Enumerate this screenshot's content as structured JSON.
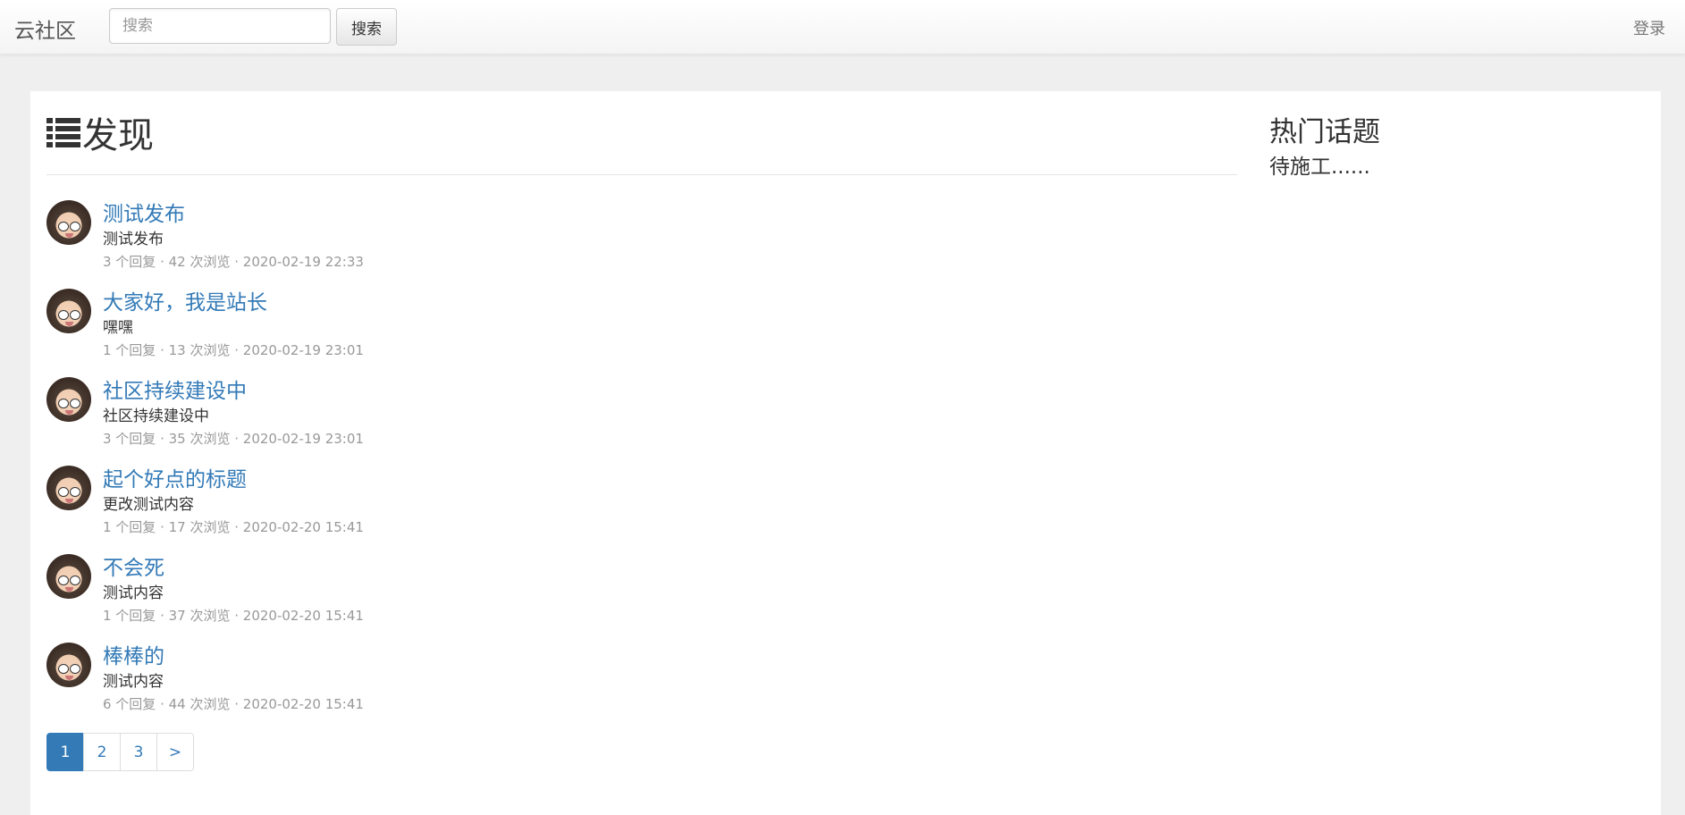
{
  "navbar": {
    "brand": "云社区",
    "search_placeholder": "搜索",
    "search_button": "搜索",
    "login": "登录"
  },
  "main": {
    "title": "发现",
    "title_icon": "list-icon",
    "topics": [
      {
        "title": "测试发布",
        "description": "测试发布",
        "meta": "3 个回复 · 42 次浏览 · 2020-02-19 22:33"
      },
      {
        "title": "大家好，我是站长",
        "description": "嘿嘿",
        "meta": "1 个回复 · 13 次浏览 · 2020-02-19 23:01"
      },
      {
        "title": "社区持续建设中",
        "description": "社区持续建设中",
        "meta": "3 个回复 · 35 次浏览 · 2020-02-19 23:01"
      },
      {
        "title": "起个好点的标题",
        "description": "更改测试内容",
        "meta": "1 个回复 · 17 次浏览 · 2020-02-20 15:41"
      },
      {
        "title": "不会死",
        "description": "测试内容",
        "meta": "1 个回复 · 37 次浏览 · 2020-02-20 15:41"
      },
      {
        "title": "棒棒的",
        "description": "测试内容",
        "meta": "6 个回复 · 44 次浏览 · 2020-02-20 15:41"
      }
    ],
    "pagination": [
      "1",
      "2",
      "3",
      ">"
    ],
    "active_page": "1"
  },
  "sidebar": {
    "title": "热门话题",
    "text": "待施工......"
  },
  "colors": {
    "link": "#337ab7",
    "meta": "#999999",
    "page_background": "#efefef"
  }
}
